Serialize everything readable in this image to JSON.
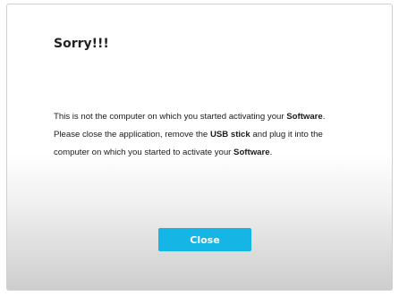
{
  "dialog": {
    "title": "Sorry!!!",
    "message": {
      "line1_text": "This is not the computer on which you started activating your ",
      "line1_bold": "Software",
      "line1_end": ".",
      "line2_text": "Please close the application, remove the ",
      "line2_bold": "USB stick",
      "line2_end": " and plug it into the",
      "line3_text": "computer on which you started to activate your ",
      "line3_bold": "Software",
      "line3_end": "."
    },
    "close_label": "Close"
  },
  "colors": {
    "accent": "#15b6e6",
    "title_text": "#222222"
  }
}
